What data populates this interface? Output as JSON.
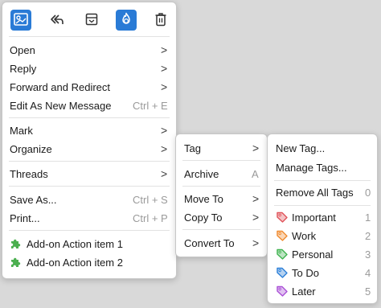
{
  "main_menu": {
    "toolbar": [
      {
        "name": "compose-image-icon"
      },
      {
        "name": "reply-arrow-icon"
      },
      {
        "name": "archive-box-icon"
      },
      {
        "name": "junk-flame-icon"
      },
      {
        "name": "trash-icon"
      }
    ],
    "items": [
      {
        "label": "Open",
        "shortcut": "",
        "submenu": true
      },
      {
        "label": "Reply",
        "shortcut": "",
        "submenu": true
      },
      {
        "label": "Forward and Redirect",
        "shortcut": "",
        "submenu": true
      },
      {
        "label": "Edit As New Message",
        "shortcut": "Ctrl + E",
        "submenu": false
      },
      {
        "label": "Mark",
        "shortcut": "",
        "submenu": true
      },
      {
        "label": "Organize",
        "shortcut": "",
        "submenu": true
      },
      {
        "label": "Threads",
        "shortcut": "",
        "submenu": true
      },
      {
        "label": "Save As...",
        "shortcut": "Ctrl + S",
        "submenu": false
      },
      {
        "label": "Print...",
        "shortcut": "Ctrl + P",
        "submenu": false
      },
      {
        "label": "Add-on Action item 1"
      },
      {
        "label": "Add-on Action item 2"
      }
    ],
    "chevron": ">"
  },
  "organize_menu": {
    "items": [
      {
        "label": "Tag",
        "shortcut": "",
        "submenu": true
      },
      {
        "label": "Archive",
        "shortcut": "A",
        "submenu": false
      },
      {
        "label": "Move To",
        "shortcut": "",
        "submenu": true
      },
      {
        "label": "Copy To",
        "shortcut": "",
        "submenu": true
      },
      {
        "label": "Convert To",
        "shortcut": "",
        "submenu": true
      }
    ]
  },
  "tag_menu": {
    "items": [
      {
        "label": "New Tag..."
      },
      {
        "label": "Manage Tags..."
      },
      {
        "label": "Remove All Tags",
        "count": "0"
      }
    ],
    "tags": [
      {
        "label": "Important",
        "count": "1",
        "color": "#e0535a"
      },
      {
        "label": "Work",
        "count": "2",
        "color": "#f08a2d"
      },
      {
        "label": "Personal",
        "count": "3",
        "color": "#3fb34f"
      },
      {
        "label": "To Do",
        "count": "4",
        "color": "#2b7fd8"
      },
      {
        "label": "Later",
        "count": "5",
        "color": "#a94fd6"
      }
    ]
  },
  "colors": {
    "accent": "#2a7bd6",
    "addon_icon": "#4caf50"
  }
}
